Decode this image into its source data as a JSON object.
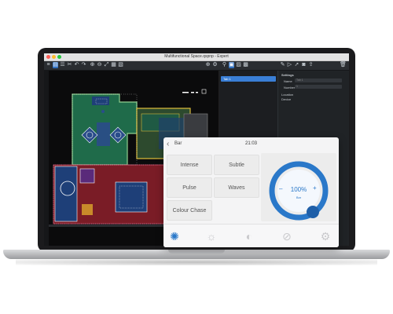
{
  "window": {
    "title": "Multifunctional Space.qspnp - Expert"
  },
  "panel": {
    "selected_item": "Tab 1",
    "section_title": "Settings",
    "name_label": "Name",
    "name_value": "Tab 1",
    "number_label": "Number",
    "number_value": "1",
    "location_label": "Location",
    "device_label": "Device"
  },
  "tablet": {
    "page_title": "Bar",
    "time": "21:03",
    "buttons": [
      "Intense",
      "Subtle",
      "Pulse",
      "Waves",
      "Colour Chase"
    ],
    "dial_value": "100%",
    "dial_minus": "–",
    "dial_plus": "+",
    "dial_label": "Bar",
    "bottom_icons": [
      "gear-multi-icon",
      "sun-icon",
      "contrast-icon",
      "compass-icon",
      "settings-icon"
    ]
  },
  "colors": {
    "accent": "#2a78c9",
    "selected": "#3a7fd6",
    "board_green": "#1f6b4a",
    "board_blue": "#1e3f78",
    "board_red": "#7a1c26",
    "board_yellow": "#d9b93a"
  }
}
